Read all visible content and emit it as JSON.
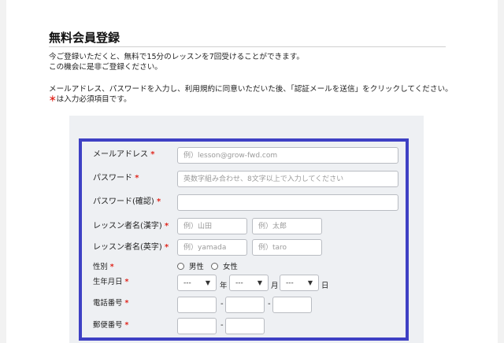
{
  "heading": "無料会員登録",
  "intro": {
    "line1": "今ご登録いただくと、無料で15分のレッスンを7回受けることができます。",
    "line2": "この機会に是非ご登録ください。",
    "line3": "メールアドレス、パスワードを入力し、利用規約に同意いただいた後、「認証メールを送信」をクリックしてください。",
    "required_mark": "＊",
    "line4": "は入力必須項目です。"
  },
  "form": {
    "required_mark": "*",
    "email": {
      "label": "メールアドレス",
      "placeholder": "例）lesson@grow-fwd.com"
    },
    "password": {
      "label": "パスワード",
      "placeholder": "英数字組み合わせ、8文字以上で入力してください"
    },
    "password_confirm": {
      "label": "パスワード(確認)",
      "placeholder": ""
    },
    "name_kanji": {
      "label": "レッスン者名(漢字)",
      "last_placeholder": "例）山田",
      "first_placeholder": "例）太郎"
    },
    "name_roman": {
      "label": "レッスン者名(英字)",
      "last_placeholder": "例）yamada",
      "first_placeholder": "例）taro"
    },
    "gender": {
      "label": "性別",
      "male": "男性",
      "female": "女性"
    },
    "birthdate": {
      "label": "生年月日",
      "year_value": "---",
      "month_value": "---",
      "day_value": "---",
      "year_unit": "年",
      "month_unit": "月",
      "day_unit": "日"
    },
    "phone": {
      "label": "電話番号",
      "separator": "-"
    },
    "postal": {
      "label": "郵便番号",
      "separator": "-"
    }
  },
  "colors": {
    "accent_border": "#3e40c4",
    "required": "#e0261d"
  }
}
